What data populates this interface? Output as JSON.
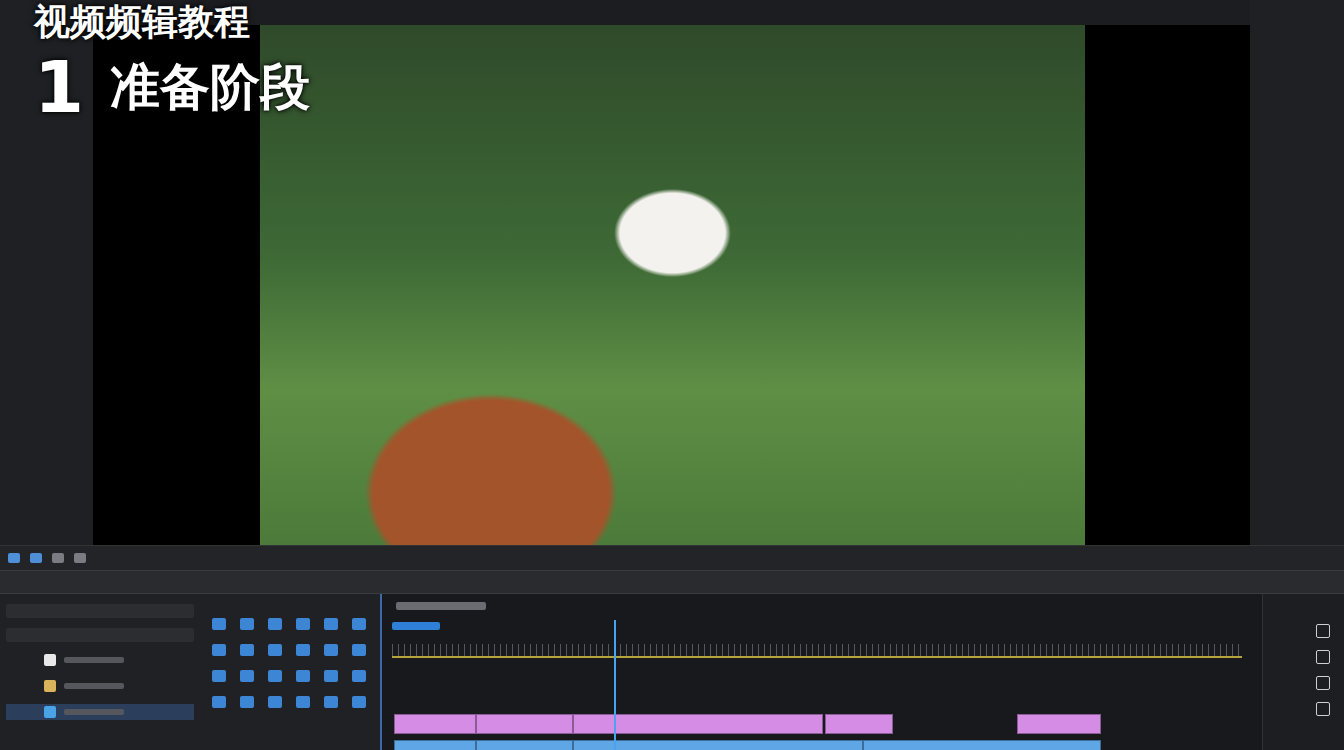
{
  "overlay": {
    "title": "视频频辑教程",
    "step_number": "1",
    "step_title": "准备阶段"
  },
  "project_items": [
    {
      "color": "#e8e8e8",
      "selected": false
    },
    {
      "color": "#d9b45a",
      "selected": false
    },
    {
      "color": "#4aa3e8",
      "selected": true
    }
  ],
  "timeline": {
    "playhead": {
      "level": 0.26
    },
    "tracks": [
      {
        "kind": "video",
        "color": "#d58ce4",
        "clips": [
          {
            "selected": false
          },
          {
            "selected": false
          },
          {
            "selected": false
          },
          {
            "selected": false
          },
          {
            "selected": false
          }
        ]
      },
      {
        "kind": "audio",
        "color": "#5ea6e6",
        "clips": [
          {
            "selected": false
          },
          {
            "selected": false
          },
          {
            "selected": false
          },
          {
            "selected": false
          }
        ]
      }
    ]
  }
}
